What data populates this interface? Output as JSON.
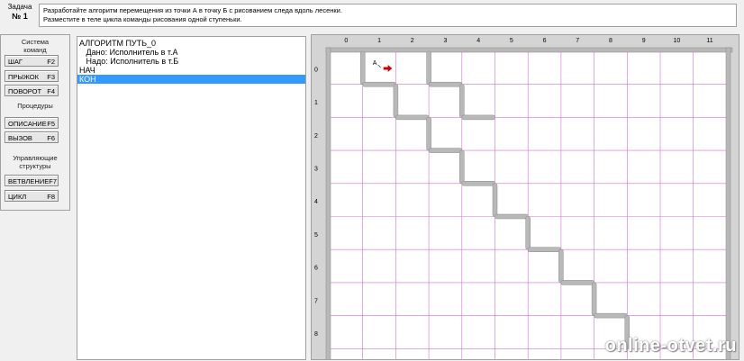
{
  "task": {
    "label": "Задача",
    "number": "№ 1",
    "text_line1": "Разработайте алгоритм перемещения из точки А в точку Б с рисованием следа вдоль лесенки.",
    "text_line2": "Разместите в теле цикла команды рисования одной ступеньки."
  },
  "commands": {
    "system_title_1": "Система",
    "system_title_2": "команд",
    "step": {
      "label": "ШАГ",
      "key": "F2"
    },
    "jump": {
      "label": "ПРЫЖОК",
      "key": "F3"
    },
    "turn": {
      "label": "ПОВОРОТ",
      "key": "F4"
    },
    "procedures_title": "Процедуры",
    "describe": {
      "label": "ОПИСАНИЕ",
      "key": "F5"
    },
    "call": {
      "label": "ВЫЗОВ",
      "key": "F6"
    },
    "control_title_1": "Управляющие",
    "control_title_2": "структуры",
    "branch": {
      "label": "ВЕТВЛЕНИЕ",
      "key": "F7"
    },
    "loop": {
      "label": "ЦИКЛ",
      "key": "F8"
    }
  },
  "editor": {
    "lines": [
      "АЛГОРИТМ ПУТЬ_0",
      "   Дано: Исполнитель в т.А",
      "   Надо: Исполнитель в т.Б",
      "НАЧ",
      "КОН"
    ],
    "selected_index": 4
  },
  "field": {
    "col_labels": [
      "0",
      "1",
      "2",
      "3",
      "4",
      "5",
      "6",
      "7",
      "8",
      "9",
      "10",
      "11"
    ],
    "row_labels": [
      "0",
      "1",
      "2",
      "3",
      "4",
      "5",
      "6",
      "7",
      "8"
    ],
    "point_a": "А",
    "grid_color": "#d070d0",
    "wall_color": "#b8b8b8",
    "arrow_color": "#cc0000"
  },
  "watermark": "online-otvet.ru"
}
